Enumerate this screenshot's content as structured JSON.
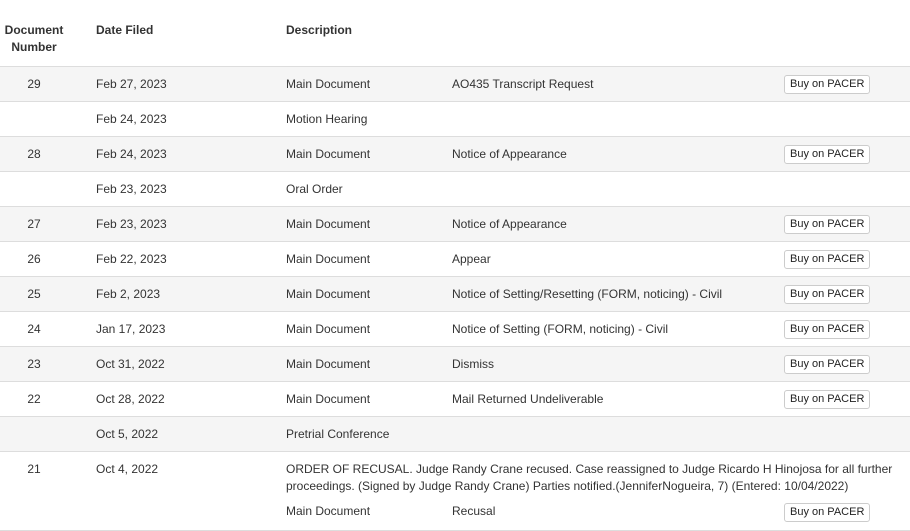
{
  "columns": {
    "number": "Document\nNumber",
    "number_line1": "Document",
    "number_line2": "Number",
    "date": "Date Filed",
    "description": "Description"
  },
  "buy_label": "Buy on PACER",
  "rows": [
    {
      "number": "29",
      "date": "Feb 27, 2023",
      "type": "Main Document",
      "desc": "AO435 Transcript Request",
      "buy": true
    },
    {
      "number": "",
      "date": "Feb 24, 2023",
      "type": "Motion Hearing",
      "desc": "",
      "buy": false
    },
    {
      "number": "28",
      "date": "Feb 24, 2023",
      "type": "Main Document",
      "desc": "Notice of Appearance",
      "buy": true
    },
    {
      "number": "",
      "date": "Feb 23, 2023",
      "type": "Oral Order",
      "desc": "",
      "buy": false
    },
    {
      "number": "27",
      "date": "Feb 23, 2023",
      "type": "Main Document",
      "desc": "Notice of Appearance",
      "buy": true
    },
    {
      "number": "26",
      "date": "Feb 22, 2023",
      "type": "Main Document",
      "desc": "Appear",
      "buy": true
    },
    {
      "number": "25",
      "date": "Feb 2, 2023",
      "type": "Main Document",
      "desc": "Notice of Setting/Resetting (FORM, noticing) - Civil",
      "buy": true
    },
    {
      "number": "24",
      "date": "Jan 17, 2023",
      "type": "Main Document",
      "desc": "Notice of Setting (FORM, noticing) - Civil",
      "buy": true
    },
    {
      "number": "23",
      "date": "Oct 31, 2022",
      "type": "Main Document",
      "desc": "Dismiss",
      "buy": true
    },
    {
      "number": "22",
      "date": "Oct 28, 2022",
      "type": "Main Document",
      "desc": "Mail Returned Undeliverable",
      "buy": true
    },
    {
      "number": "",
      "date": "Oct 5, 2022",
      "type": "Pretrial Conference",
      "desc": "",
      "buy": false
    }
  ],
  "order_row": {
    "number": "21",
    "date": "Oct 4, 2022",
    "text": "ORDER OF RECUSAL. Judge Randy Crane recused. Case reassigned to Judge Ricardo H Hinojosa for all further proceedings. (Signed by Judge Randy Crane) Parties notified.(JenniferNogueira, 7) (Entered: 10/04/2022)",
    "type": "Main Document",
    "desc": "Recusal"
  }
}
